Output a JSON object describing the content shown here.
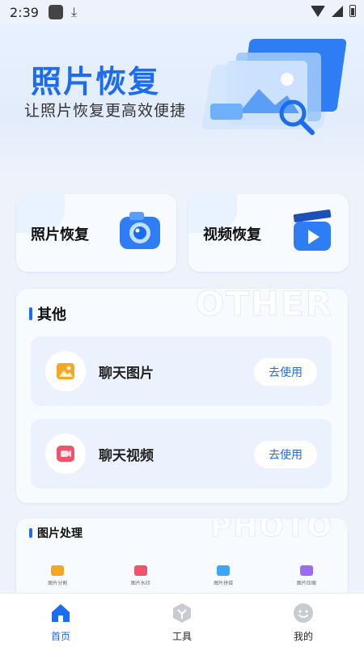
{
  "status_bar": {
    "time": "2:39"
  },
  "hero": {
    "title": "照片恢复",
    "subtitle": "让照片恢复更高效便捷"
  },
  "features": [
    {
      "label": "照片恢复",
      "icon": "camera-icon"
    },
    {
      "label": "视频恢复",
      "icon": "video-clapper-icon"
    }
  ],
  "other": {
    "title": "其他",
    "watermark": "OTHER",
    "items": [
      {
        "label": "聊天图片",
        "button": "去使用",
        "icon": "image-icon"
      },
      {
        "label": "聊天视频",
        "button": "去使用",
        "icon": "video-icon"
      }
    ]
  },
  "photo_processing": {
    "title": "图片处理",
    "watermark": "PHOTO",
    "tools": [
      {
        "label": "图片分割",
        "color": "#f5a623"
      },
      {
        "label": "图片水印",
        "color": "#f0546a"
      },
      {
        "label": "图片拼接",
        "color": "#3ba6f5"
      },
      {
        "label": "图片压缩",
        "color": "#9b6cf0"
      }
    ]
  },
  "tabbar": {
    "items": [
      {
        "label": "首页",
        "icon": "home-icon",
        "active": true
      },
      {
        "label": "工具",
        "icon": "tools-icon",
        "active": false
      },
      {
        "label": "我的",
        "icon": "profile-icon",
        "active": false
      }
    ]
  },
  "colors": {
    "accent": "#1d6cf0",
    "background": "#eef3fb"
  }
}
